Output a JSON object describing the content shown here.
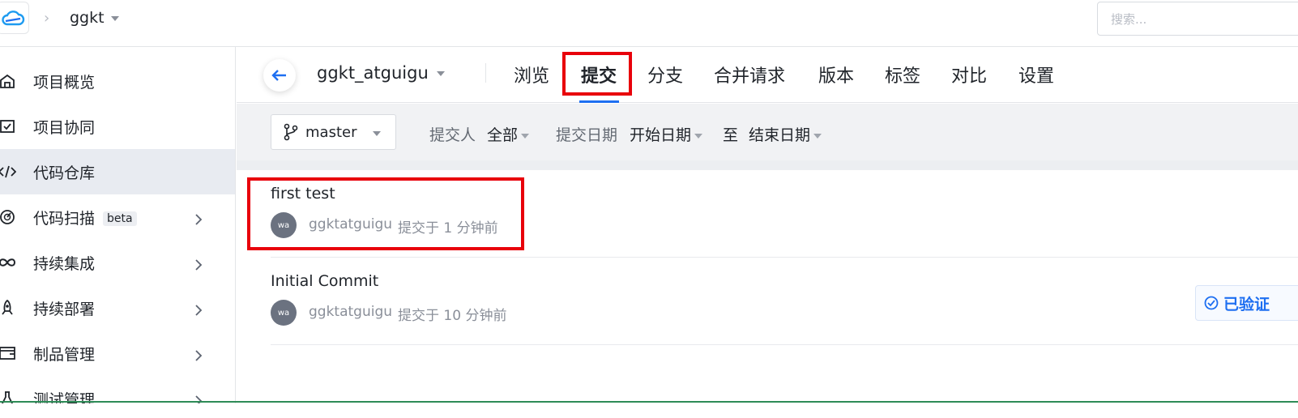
{
  "topbar": {
    "project": "ggkt",
    "search_placeholder": "搜索..."
  },
  "sidebar": {
    "items": [
      {
        "label": "项目概览",
        "icon": "home-icon"
      },
      {
        "label": "项目协同",
        "icon": "checkbox-icon"
      },
      {
        "label": "代码仓库",
        "icon": "code-icon",
        "active": true
      },
      {
        "label": "代码扫描",
        "icon": "scan-icon",
        "badge": "beta"
      },
      {
        "label": "持续集成",
        "icon": "infinity-icon"
      },
      {
        "label": "持续部署",
        "icon": "rocket-icon"
      },
      {
        "label": "制品管理",
        "icon": "wallet-icon"
      },
      {
        "label": "测试管理",
        "icon": "flask-icon"
      }
    ]
  },
  "header": {
    "repo": "ggkt_atguigu",
    "tabs": [
      "浏览",
      "提交",
      "分支",
      "合并请求",
      "版本",
      "标签",
      "对比",
      "设置"
    ],
    "active_tab": "提交"
  },
  "filters": {
    "branch": "master",
    "committer_label": "提交人",
    "committer_value": "全部",
    "date_label": "提交日期",
    "start_date": "开始日期",
    "to": "至",
    "end_date": "结束日期"
  },
  "commits": [
    {
      "title": "first test",
      "avatar": "wa",
      "author": "ggktatguigu",
      "time": "提交于 1 分钟前"
    },
    {
      "title": "Initial Commit",
      "avatar": "wa",
      "author": "ggktatguigu",
      "time": "提交于 10 分钟前",
      "badge": "已验证"
    }
  ],
  "colors": {
    "accent": "#1e6ff1",
    "highlight": "#e8000b"
  }
}
